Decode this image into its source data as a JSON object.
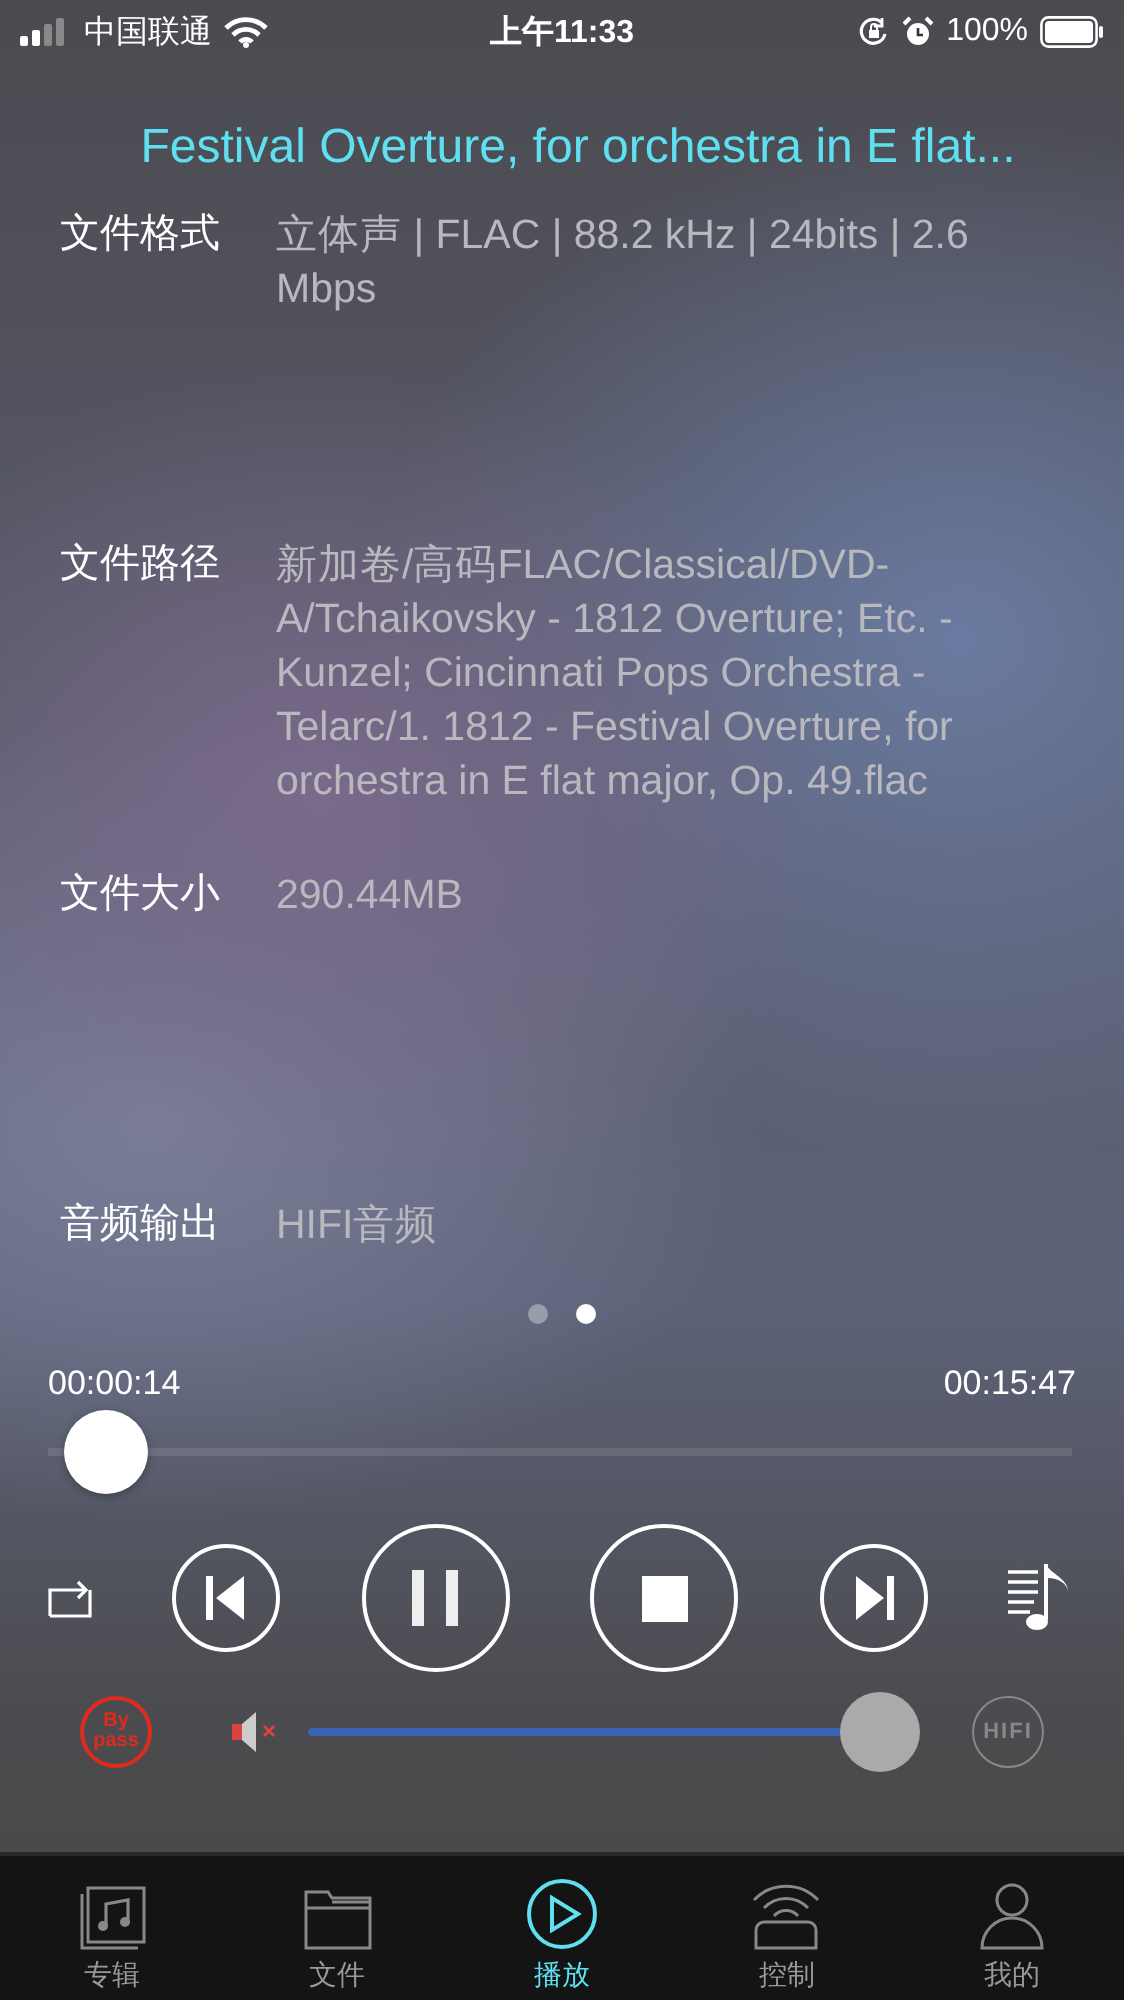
{
  "status_bar": {
    "carrier": "中国联通",
    "time": "上午11:33",
    "battery": "100%"
  },
  "title": "Festival Overture, for orchestra in E flat...",
  "info": [
    {
      "label": "文件格式",
      "value": "立体声 | FLAC | 88.2 kHz | 24bits | 2.6 Mbps"
    },
    {
      "label": "文件路径",
      "value": "新加卷/高码FLAC/Classical/DVD-A/Tchaikovsky - 1812 Overture; Etc. - Kunzel; Cincinnati Pops Orchestra - Telarc/1. 1812 - Festival Overture, for orchestra in E flat major, Op. 49.flac"
    },
    {
      "label": "文件大小",
      "value": "290.44MB"
    },
    {
      "label": "音频输出",
      "value": "HIFI音频"
    }
  ],
  "pages": [
    {
      "selected": false
    },
    {
      "selected": true
    }
  ],
  "progress": {
    "elapsed": "00:00:14",
    "total": "00:15:47",
    "level": 0.015
  },
  "bypass": {
    "label": "By pass",
    "on": true
  },
  "volume": {
    "level": 0.93
  },
  "hifi": {
    "label": "HIFI",
    "on": false
  },
  "tabs": [
    {
      "label": "专辑",
      "selected": false
    },
    {
      "label": "文件",
      "selected": false
    },
    {
      "label": "播放",
      "selected": true
    },
    {
      "label": "控制",
      "selected": false
    },
    {
      "label": "我的",
      "selected": false
    }
  ]
}
